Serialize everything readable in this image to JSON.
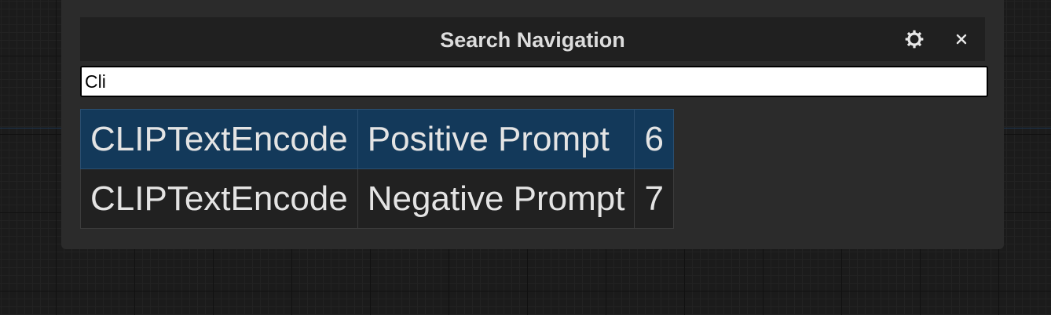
{
  "panel": {
    "title": "Search Navigation",
    "settings_icon": "gear-icon",
    "close_icon": "close-icon",
    "close_label": "✕"
  },
  "search": {
    "value": "Cli",
    "placeholder": ""
  },
  "results": [
    {
      "type": "CLIPTextEncode",
      "title": "Positive Prompt",
      "id": "6",
      "selected": true
    },
    {
      "type": "CLIPTextEncode",
      "title": "Negative Prompt",
      "id": "7",
      "selected": false
    }
  ],
  "colors": {
    "panel_bg": "#2b2b2b",
    "header_bg": "#202020",
    "selected_row": "#13395a",
    "row_bg": "#212121"
  }
}
